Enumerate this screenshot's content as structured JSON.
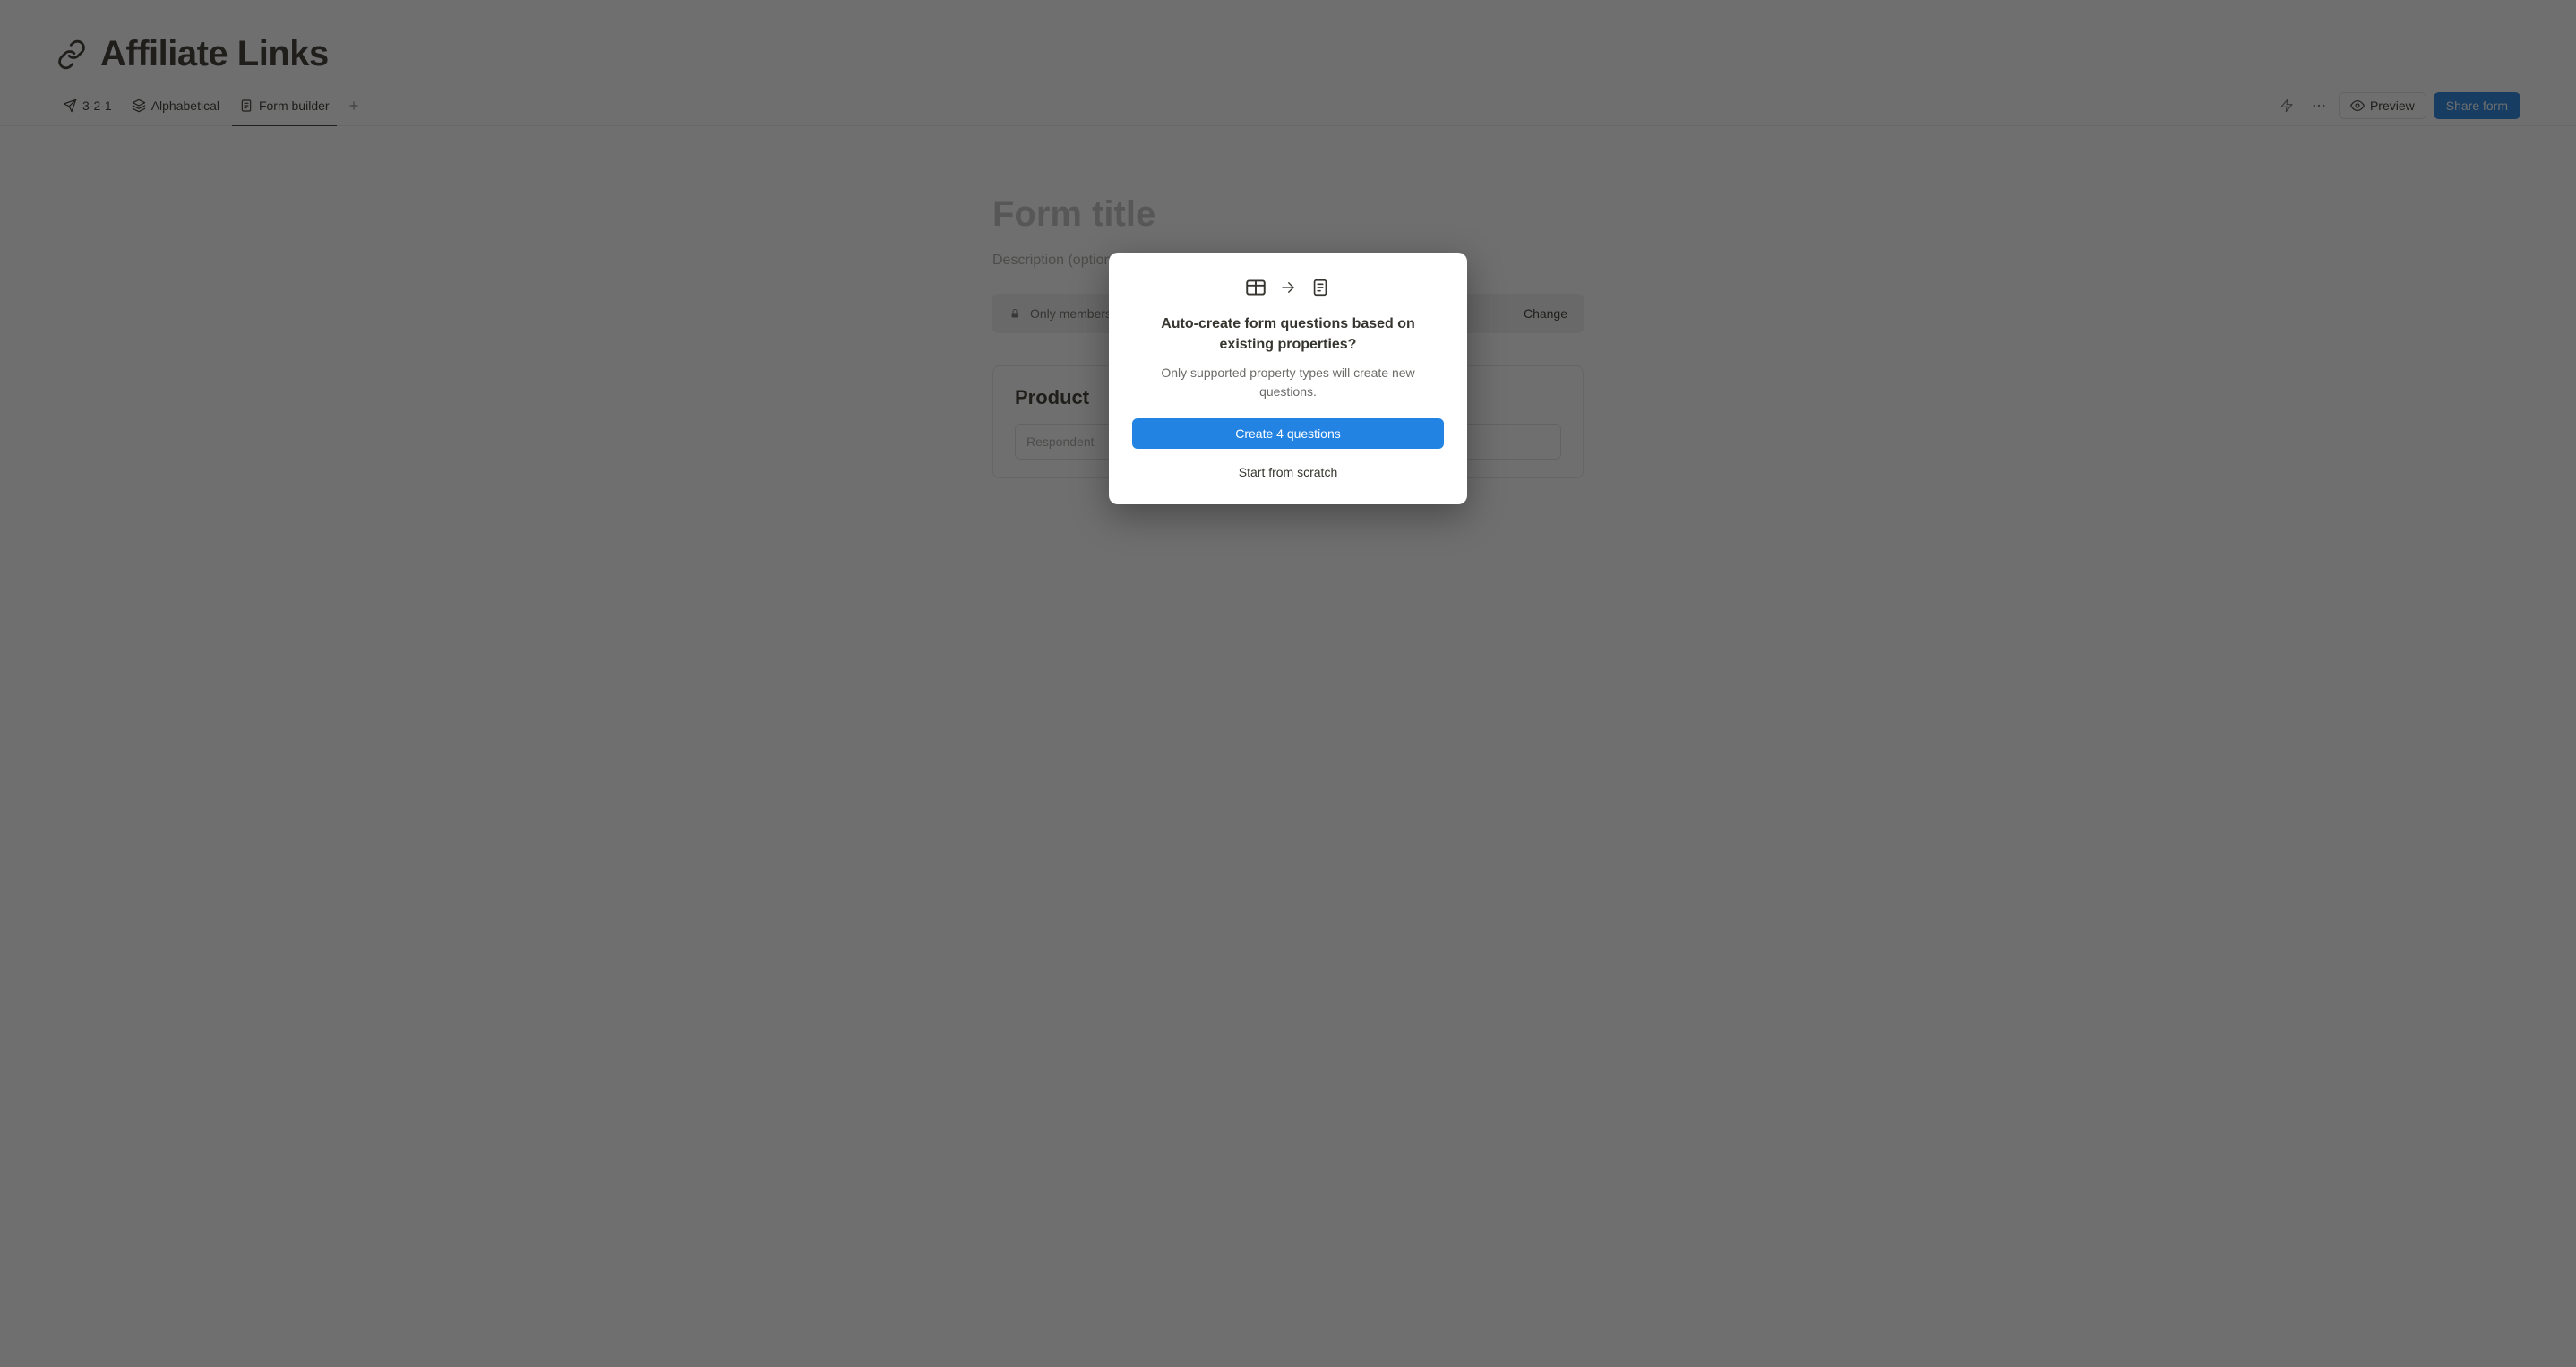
{
  "page": {
    "title": "Affiliate Links"
  },
  "tabs": {
    "items": [
      {
        "label": "3-2-1"
      },
      {
        "label": "Alphabetical"
      },
      {
        "label": "Form builder"
      }
    ],
    "active_index": 2
  },
  "toolbar": {
    "preview_label": "Preview",
    "share_label": "Share form"
  },
  "form": {
    "title_placeholder": "Form title",
    "description_placeholder": "Description (optional)",
    "access_text": "Only members",
    "access_change_label": "Change",
    "question_title": "Product",
    "answer_placeholder": "Respondent"
  },
  "modal": {
    "title": "Auto-create form questions based on existing properties?",
    "subtitle": "Only supported property types will create new questions.",
    "primary_label": "Create 4 questions",
    "secondary_label": "Start from scratch"
  }
}
